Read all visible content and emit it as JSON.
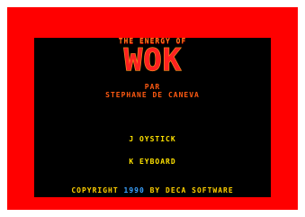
{
  "title_screen": {
    "subtitle": "THE ENERGY OF",
    "logo_text": "WOK",
    "by_label": "PAR",
    "author": "STEPHANE DE CANEVA",
    "options": {
      "joystick": "J OYSTICK",
      "keyboard": "K EYBOARD"
    },
    "copyright": {
      "prefix": "COPYRIGHT",
      "year": "1990",
      "suffix": "BY DECA SOFTWARE"
    }
  },
  "colors": {
    "border": "#ff0000",
    "screen_background": "#000000",
    "logo_fill": "#ff2020",
    "logo_highlight": "#ff9a20",
    "credit_text": "#ff5a12",
    "option_text": "#ffe200",
    "copyright_text": "#ffd000",
    "year_text": "#3aa2ff"
  }
}
